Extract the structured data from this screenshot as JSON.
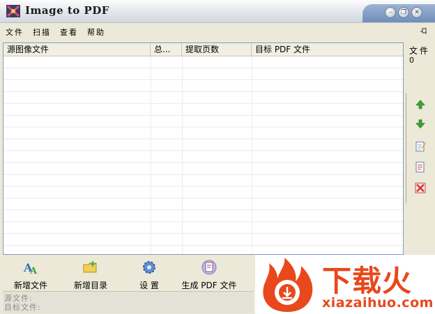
{
  "window": {
    "title": "Image to PDF"
  },
  "menu": [
    "文件",
    "扫描",
    "查看",
    "帮助"
  ],
  "table": {
    "columns": [
      "源图像文件",
      "总...",
      "提取页数",
      "目标 PDF 文件"
    ],
    "rows": []
  },
  "counter": {
    "label": "文件",
    "value": "0"
  },
  "toolbar": {
    "add_file": "新增文件",
    "add_folder": "新增目录",
    "settings": "设 置",
    "generate": "生成 PDF 文件"
  },
  "status": {
    "source": "源文件:",
    "target": "目标文件:"
  },
  "watermark": {
    "main": "下载火",
    "sub": "xiazaihuo.com"
  },
  "colors": {
    "accent": "#e8481c",
    "arrow_green": "#3aa53a",
    "delete_red": "#d03a2c"
  }
}
